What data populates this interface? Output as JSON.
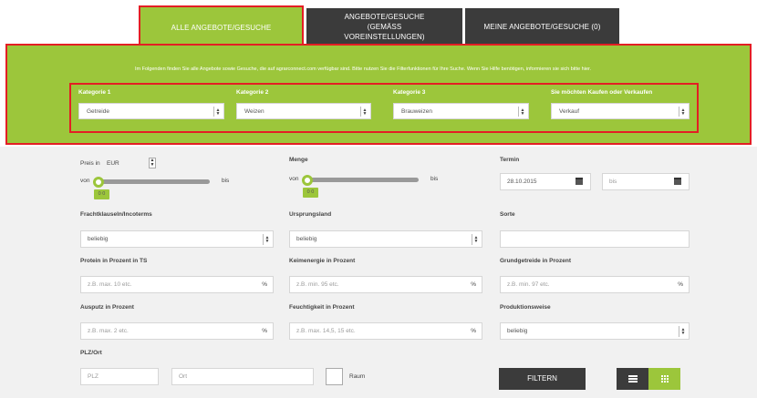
{
  "tabs": [
    {
      "label": "ALLE ANGEBOTE/GESUCHE"
    },
    {
      "label": "ANGEBOTE/GESUCHE (GEMÄSS VOREINSTELLUNGEN)"
    },
    {
      "label": "MEINE ANGEBOTE/GESUCHE (0)"
    }
  ],
  "intro": "Im Folgenden finden Sie alle Angebote sowie Gesuche, die auf agrarconnect.com verfügbar sind. Bitte nutzen Sie die Filterfunktionen für Ihre Suche. Wenn Sie Hilfe benötigen, informieren sie sich bitte hier.",
  "categories": [
    {
      "label": "Kategorie 1",
      "value": "Getreide"
    },
    {
      "label": "Kategorie 2",
      "value": "Weizen"
    },
    {
      "label": "Kategorie 3",
      "value": "Brauweizen"
    },
    {
      "label": "Sie möchten Kaufen oder Verkaufen",
      "value": "Verkauf"
    }
  ],
  "price": {
    "label": "Preis in",
    "currency": "EUR",
    "from": "von",
    "to": "bis",
    "value": "0 0"
  },
  "quantity": {
    "label": "Menge",
    "from": "von",
    "to": "bis",
    "value": "0 0"
  },
  "date": {
    "label": "Termin",
    "from_value": "28.10.2015",
    "to_placeholder": "bis"
  },
  "freight": {
    "label": "Frachtklauseln/Incoterms",
    "value": "beliebig"
  },
  "origin": {
    "label": "Ursprungsland",
    "value": "beliebig"
  },
  "variety": {
    "label": "Sorte",
    "value": ""
  },
  "protein": {
    "label": "Protein in Prozent in TS",
    "placeholder": "z.B. max. 10 etc.",
    "unit": "%"
  },
  "germination": {
    "label": "Keimenergie in Prozent",
    "placeholder": "z.B. min. 95 etc.",
    "unit": "%"
  },
  "base_grain": {
    "label": "Grundgetreide in Prozent",
    "placeholder": "z.B. min. 97 etc.",
    "unit": "%"
  },
  "screenings": {
    "label": "Ausputz in Prozent",
    "placeholder": "z.B. max. 2 etc.",
    "unit": "%"
  },
  "moisture": {
    "label": "Feuchtigkeit in Prozent",
    "placeholder": "z.B. max. 14,5, 15 etc.",
    "unit": "%"
  },
  "production": {
    "label": "Produktionsweise",
    "value": "beliebig"
  },
  "location": {
    "label": "PLZ/Ort",
    "plz_placeholder": "PLZ",
    "ort_placeholder": "Ort",
    "raum_label": "Raum"
  },
  "filter_button": "FILTERN",
  "colors": {
    "accent": "#9cc63b",
    "dark": "#3b3b3b",
    "highlight": "#e31e24",
    "panel": "#f1f1f1"
  }
}
